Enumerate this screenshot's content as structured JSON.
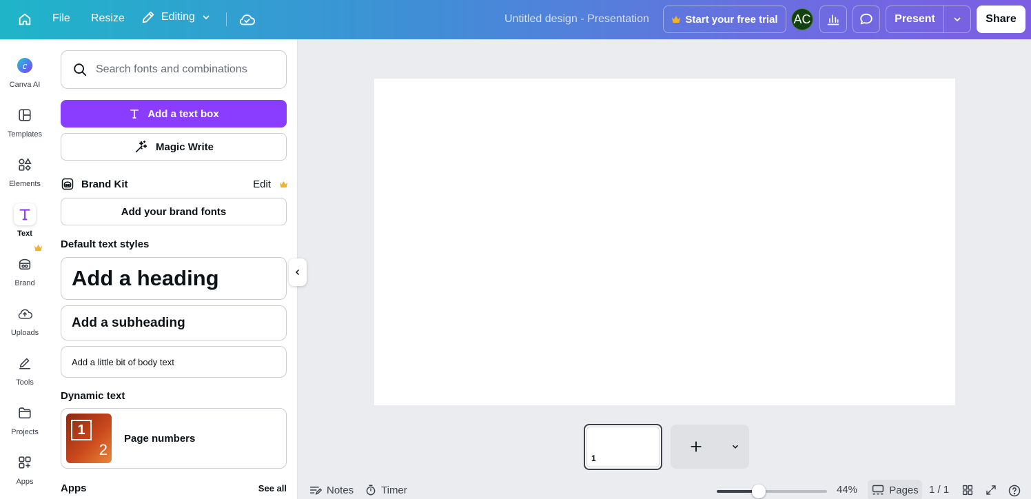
{
  "topbar": {
    "file": "File",
    "resize": "Resize",
    "editing": "Editing",
    "title": "Untitled design - Presentation",
    "trial": "Start your free trial",
    "avatar": "AC",
    "present": "Present",
    "share": "Share"
  },
  "rail": [
    {
      "label": "Canva AI",
      "icon": "canva-ai-icon"
    },
    {
      "label": "Templates",
      "icon": "templates-icon"
    },
    {
      "label": "Elements",
      "icon": "elements-icon"
    },
    {
      "label": "Text",
      "icon": "text-icon",
      "active": true
    },
    {
      "label": "Brand",
      "icon": "brand-icon"
    },
    {
      "label": "Uploads",
      "icon": "uploads-icon"
    },
    {
      "label": "Tools",
      "icon": "tools-icon"
    },
    {
      "label": "Projects",
      "icon": "projects-icon"
    },
    {
      "label": "Apps",
      "icon": "apps-icon"
    }
  ],
  "panel": {
    "search_placeholder": "Search fonts and combinations",
    "add_text_box": "Add a text box",
    "magic_write": "Magic Write",
    "brand_kit": "Brand Kit",
    "edit": "Edit",
    "add_brand_fonts": "Add your brand fonts",
    "default_styles": "Default text styles",
    "heading": "Add a heading",
    "subheading": "Add a subheading",
    "body": "Add a little bit of body text",
    "dynamic_text": "Dynamic text",
    "thumb_1": "1",
    "thumb_2": "2",
    "page_numbers": "Page numbers",
    "apps": "Apps",
    "see_all": "See all"
  },
  "canvas": {
    "page_number": "1"
  },
  "bottombar": {
    "notes": "Notes",
    "timer": "Timer",
    "zoom": "44%",
    "zoom_fraction": 0.38,
    "pages": "Pages",
    "page_count": "1 / 1"
  },
  "colors": {
    "accent": "#8b3dff",
    "crown": "#f0b429",
    "avatar_bg": "#12430e"
  }
}
